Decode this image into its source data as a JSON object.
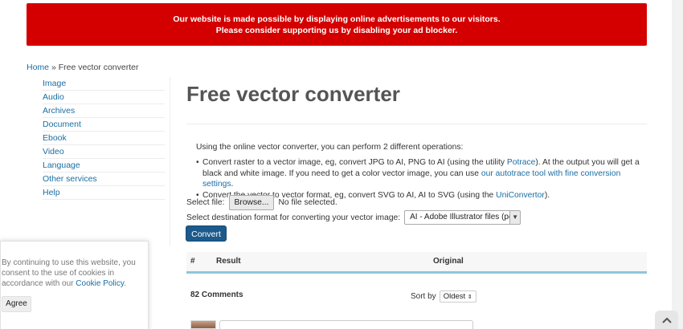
{
  "ad_banner": {
    "line1": "Our website is made possible by displaying online advertisements to our visitors.",
    "line2": "Please consider supporting us by disabling your ad blocker."
  },
  "breadcrumb": {
    "home": "Home",
    "separator": "»",
    "current": "Free vector converter"
  },
  "sidebar": {
    "items": [
      {
        "label": "Image"
      },
      {
        "label": "Audio"
      },
      {
        "label": "Archives"
      },
      {
        "label": "Document"
      },
      {
        "label": "Ebook"
      },
      {
        "label": "Video"
      },
      {
        "label": "Language"
      },
      {
        "label": "Other services"
      },
      {
        "label": "Help"
      }
    ]
  },
  "main": {
    "title": "Free vector converter",
    "intro": "Using the online vector converter, you can perform 2 different operations:",
    "op1_a": "Convert raster to a vector image, eg, convert JPG to AI, PNG to AI (using the utility ",
    "op1_link": "Potrace",
    "op1_b": "). At the output you will get a black and white image. If you need to get a color vector image, you can use ",
    "op1_link2": "our autotrace tool with fine conversion settings",
    "op1_c": ".",
    "op2_a": "Convert the vector to vector format, eg, convert SVG to AI, AI to SVG (using the ",
    "op2_link": "UniConvertor",
    "op2_b": ").",
    "select_file_label": "Select file:",
    "browse_label": "Browse...",
    "no_file": "No file selected.",
    "format_label": "Select destination format for converting your vector image:",
    "format_value": "AI - Adobe Illustrator files (pos",
    "convert_label": "Convert"
  },
  "table": {
    "col_num": "#",
    "col_result": "Result",
    "col_original": "Original"
  },
  "comments": {
    "count_label": "82 Comments",
    "sort_label": "Sort by",
    "sort_value": "Oldest"
  },
  "cookie": {
    "text": "By continuing to use this website, you consent to the use of cookies in accordance with our ",
    "link": "Cookie Policy",
    "end": ".",
    "agree": "Agree"
  },
  "icons": {
    "sort": "sort-updown-icon",
    "select": "dropdown-arrow-icon",
    "back_to_top": "chevron-up-icon"
  },
  "colors": {
    "ad_banner": "#d40000",
    "link": "#1a6ea3",
    "convert_button": "#1d5a8c",
    "table_bar": "#8fc5d9"
  }
}
